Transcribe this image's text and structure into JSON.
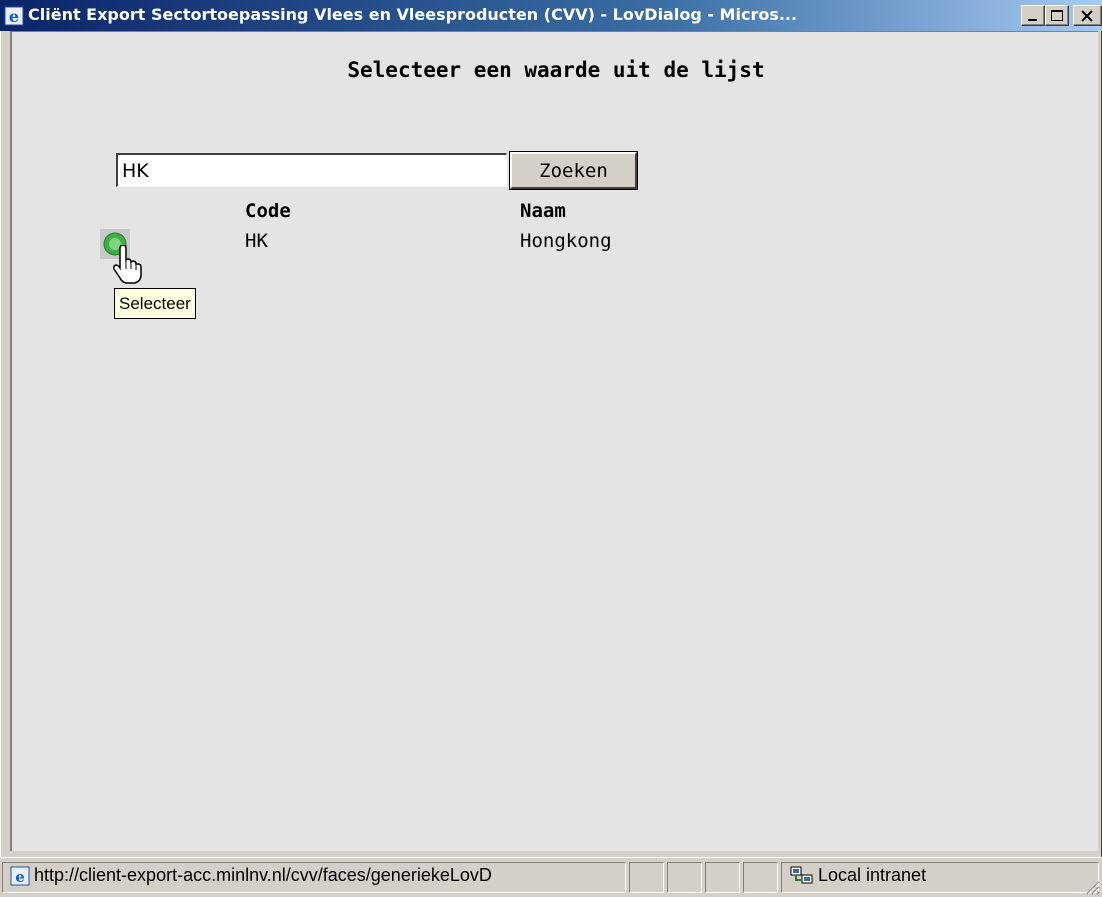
{
  "window": {
    "title": "Cliënt Export Sectortoepassing Vlees en Vleesproducten (CVV) - LovDialog - Micros...",
    "buttons": [
      "minimize",
      "maximize",
      "close"
    ]
  },
  "page": {
    "heading": "Selecteer een waarde uit de lijst",
    "search": {
      "value": "HK",
      "button_label": "Zoeken"
    },
    "table": {
      "columns": [
        "Code",
        "Naam"
      ],
      "rows": [
        {
          "code": "HK",
          "naam": "Hongkong"
        }
      ]
    },
    "tooltip": "Selecteer"
  },
  "statusbar": {
    "url": "http://client-export-acc.minlnv.nl/cvv/faces/generiekeLovD",
    "zone": "Local intranet"
  },
  "colors": {
    "titlebar_start": "#0a246a",
    "titlebar_end": "#a6caf0",
    "content_bg": "#e4e4e4",
    "tooltip_bg": "#ffffe1",
    "select_icon": "#3cb043"
  },
  "icons": [
    "ie-icon",
    "minimize-icon",
    "maximize-icon",
    "close-icon",
    "select-icon",
    "hand-cursor-icon",
    "ie-page-icon",
    "local-intranet-icon",
    "resize-grip-icon"
  ]
}
